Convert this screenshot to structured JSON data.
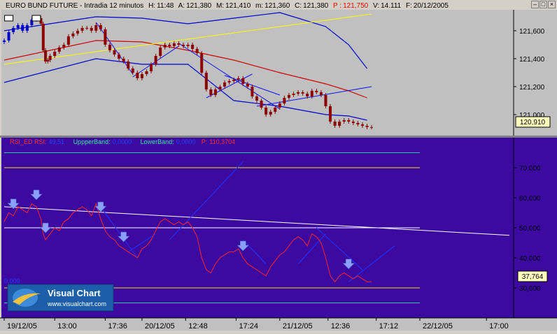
{
  "window_buttons": {
    "minimize": "–",
    "maximize": "□",
    "close": "×"
  },
  "price_panel": {
    "header": {
      "instrument": "EURO BUND FUTURE",
      "sep1": " - ",
      "interval": "Intradia 12 minutos",
      "hour_label": "H:",
      "hour_value": "11:48",
      "open_label": "A:",
      "open_value": "121,380",
      "high_label": "M:",
      "high_value": "121,410",
      "low_label": "m:",
      "low_value": "121,360",
      "close_label": "C:",
      "close_value": "121,380",
      "price_label": "P :",
      "price_value": "121,750",
      "volume_label": "V:",
      "volume_value": "14.111",
      "date_label": "F:",
      "date_value": "20/12/2005"
    },
    "last_price_tag": "120,910",
    "colors": {
      "background": "#c0c0c0",
      "candles": "#8b0000",
      "early_candles": "#0000c8",
      "ma": "#d00000",
      "bands": "#0000d0",
      "trend_yellow": "#ffff00",
      "trend_blue": "#1010ff",
      "tag_bg": "#ffffc0"
    }
  },
  "rsi_panel": {
    "header": {
      "rsi_label": "RSI_ED  RSI:",
      "rsi_value": "49,51",
      "upper_label": "UppperBand:",
      "upper_value": "0,0000",
      "lower_label": "LowerBand:",
      "lower_value": "0,0000",
      "p_label": "P:",
      "p_value": "110,3704"
    },
    "last_value_tag": "37,764",
    "left_value": "0,000",
    "colors": {
      "background": "#3c0aa0",
      "rsi_line": "#ff2020",
      "hline_yellow": "#f0e000",
      "hline_teal": "#30c0b0",
      "hline_white": "#ffffff",
      "trend_white": "#ffffff",
      "trend_blue": "#2030ff",
      "arrow": "#8aa0ff",
      "tag_bg": "#ffffc0"
    }
  },
  "chart_data": [
    {
      "type": "candlestick",
      "title": "EURO BUND FUTURE - Intradia 12 minutos",
      "ylim": [
        120850,
        121750
      ],
      "yticks": [
        "121,600",
        "121,400",
        "121,200",
        "121,000"
      ],
      "ytick_values": [
        121600,
        121400,
        121200,
        121000
      ],
      "series": [
        {
          "name": "price",
          "x": [
            0,
            2,
            4,
            6,
            8,
            10,
            12,
            14,
            16,
            17,
            18,
            19,
            20,
            22,
            24,
            26,
            28,
            30,
            32,
            34,
            36,
            38,
            40,
            42,
            44,
            46,
            48,
            50,
            52,
            54,
            56,
            58,
            60,
            62,
            64,
            66,
            68,
            70,
            72,
            74,
            76,
            78,
            80,
            82,
            84,
            86,
            88,
            90,
            92,
            94,
            96,
            98,
            100,
            102,
            104,
            106,
            108,
            110,
            112,
            114,
            116,
            118,
            120,
            122,
            124,
            126,
            128,
            130,
            132,
            134,
            136,
            138,
            140,
            142,
            144,
            146,
            148,
            150,
            152,
            154,
            156,
            158,
            160
          ],
          "values": [
            121530,
            121590,
            121620,
            121640,
            121600,
            121640,
            121680,
            121690,
            121650,
            121460,
            121380,
            121390,
            121420,
            121450,
            121480,
            121500,
            121560,
            121580,
            121600,
            121620,
            121620,
            121600,
            121640,
            121610,
            121500,
            121460,
            121430,
            121400,
            121380,
            121330,
            121300,
            121260,
            121290,
            121310,
            121360,
            121420,
            121480,
            121500,
            121490,
            121510,
            121500,
            121490,
            121500,
            121470,
            121440,
            121300,
            121180,
            121140,
            121180,
            121200,
            121230,
            121240,
            121250,
            121260,
            121220,
            121200,
            121130,
            121100,
            121050,
            121000,
            121020,
            121050,
            121080,
            121120,
            121140,
            121150,
            121160,
            121150,
            121130,
            121170,
            121160,
            121140,
            121060,
            120950,
            120920,
            120950,
            120960,
            120950,
            120940,
            120930,
            120920,
            120910,
            120910
          ]
        },
        {
          "name": "moving_average",
          "x": [
            0,
            40,
            60,
            80,
            100,
            120,
            140,
            150,
            158
          ],
          "values": [
            121390,
            121530,
            121520,
            121460,
            121390,
            121300,
            121220,
            121170,
            121120
          ]
        },
        {
          "name": "upper_band",
          "x": [
            0,
            40,
            60,
            80,
            100,
            120,
            140,
            150,
            158
          ],
          "values": [
            121600,
            121700,
            121690,
            121650,
            121690,
            121730,
            121630,
            121500,
            121330
          ]
        },
        {
          "name": "lower_band",
          "x": [
            0,
            40,
            60,
            80,
            100,
            120,
            140,
            150,
            158
          ],
          "values": [
            121230,
            121400,
            121360,
            121360,
            121100,
            121060,
            121000,
            120990,
            120960
          ]
        }
      ]
    },
    {
      "type": "line",
      "title": "RSI_ED",
      "ylim": [
        20,
        80
      ],
      "yticks": [
        "70,000",
        "60,000",
        "50,000",
        "40,000",
        "30,000"
      ],
      "ytick_values": [
        70,
        60,
        50,
        40,
        30
      ],
      "hlines": [
        {
          "value": 75,
          "color": "teal"
        },
        {
          "value": 70,
          "color": "yellow"
        },
        {
          "value": 50,
          "color": "white"
        },
        {
          "value": 30,
          "color": "yellow"
        },
        {
          "value": 25,
          "color": "teal"
        }
      ],
      "series": [
        {
          "name": "RSI",
          "x": [
            0,
            2,
            4,
            6,
            8,
            10,
            12,
            14,
            16,
            17,
            18,
            19,
            20,
            22,
            24,
            26,
            28,
            30,
            32,
            34,
            36,
            38,
            40,
            42,
            44,
            46,
            48,
            50,
            52,
            54,
            56,
            58,
            60,
            62,
            64,
            66,
            68,
            70,
            72,
            74,
            76,
            78,
            80,
            82,
            84,
            86,
            88,
            90,
            92,
            94,
            96,
            98,
            100,
            102,
            104,
            106,
            108,
            110,
            112,
            114,
            116,
            118,
            120,
            122,
            124,
            126,
            128,
            130,
            132,
            134,
            136,
            138,
            140,
            142,
            144,
            146,
            148,
            150,
            152,
            154,
            156,
            158,
            160
          ],
          "values": [
            52,
            55,
            54,
            57,
            56,
            55,
            58,
            57,
            53,
            48,
            46,
            47,
            48,
            50,
            49,
            52,
            53,
            55,
            56,
            57,
            56,
            54,
            58,
            53,
            49,
            47,
            46,
            44,
            43,
            42,
            41,
            40,
            43,
            44,
            46,
            49,
            52,
            53,
            52,
            51,
            52,
            51,
            52,
            50,
            47,
            40,
            36,
            35,
            38,
            40,
            41,
            42,
            42,
            43,
            40,
            38,
            37,
            36,
            35,
            34,
            37,
            39,
            41,
            42,
            44,
            46,
            47,
            46,
            44,
            48,
            47,
            45,
            40,
            34,
            32,
            34,
            35,
            34,
            33,
            34,
            33,
            32,
            32
          ]
        }
      ],
      "signal_markers_x": [
        4,
        14,
        18,
        42,
        52,
        104,
        150
      ]
    }
  ],
  "time_axis": {
    "labels": [
      "19/12/05",
      "13:00",
      "17:36",
      "20/12/05",
      "12:48",
      "17:24",
      "21/12/05",
      "12:36",
      "17:12",
      "22/12/05",
      "17:00"
    ],
    "label_x": [
      0,
      22,
      44,
      60,
      79,
      101,
      120,
      141,
      162,
      181,
      210
    ],
    "x_range": [
      0,
      220
    ]
  },
  "logo": {
    "brand": "Visual Chart",
    "url": "www.visualchart.com"
  }
}
